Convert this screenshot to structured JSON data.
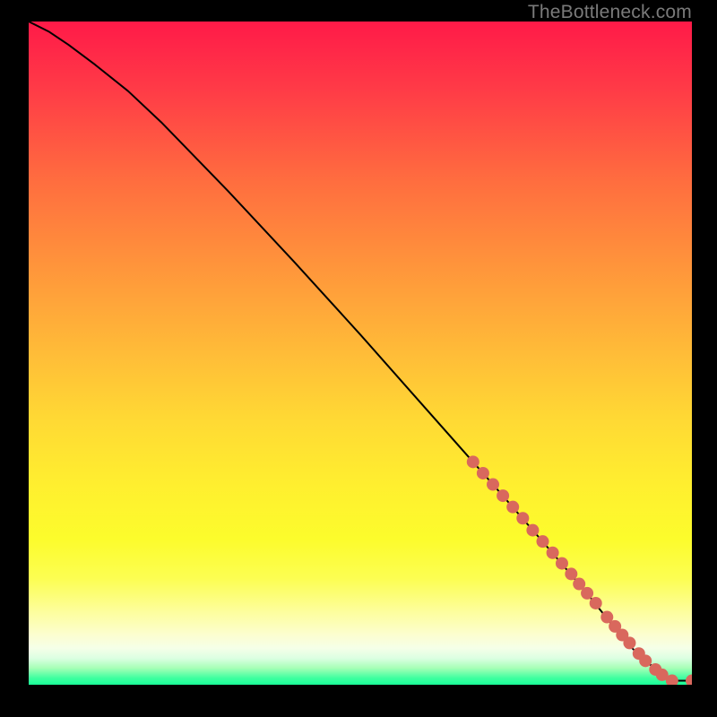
{
  "watermark": "TheBottleneck.com",
  "chart_data": {
    "type": "line",
    "title": "",
    "xlabel": "",
    "ylabel": "",
    "xlim": [
      0,
      100
    ],
    "ylim": [
      0,
      100
    ],
    "grid": false,
    "legend": false,
    "series": [
      {
        "name": "curve",
        "type": "line",
        "color": "#000000",
        "x": [
          0,
          3,
          6,
          10,
          15,
          20,
          30,
          40,
          50,
          60,
          70,
          78,
          84,
          88,
          91,
          93.5,
          95,
          96.5,
          98,
          100
        ],
        "y": [
          100,
          98.5,
          96.5,
          93.5,
          89.5,
          84.8,
          74.5,
          63.8,
          52.8,
          41.5,
          30.2,
          21.0,
          14.0,
          9.0,
          5.5,
          3.2,
          2.0,
          1.0,
          0.6,
          0.6
        ]
      },
      {
        "name": "markers",
        "type": "scatter",
        "color": "#d9685d",
        "radius": 7,
        "x": [
          67.0,
          68.5,
          70.0,
          71.5,
          73.0,
          74.5,
          76.0,
          77.5,
          79.0,
          80.4,
          81.8,
          83.0,
          84.2,
          85.5,
          87.2,
          88.4,
          89.5,
          90.6,
          92.0,
          93.0,
          94.5,
          95.5,
          97.0,
          100.0
        ],
        "y": [
          33.6,
          31.9,
          30.2,
          28.5,
          26.8,
          25.1,
          23.3,
          21.6,
          19.9,
          18.3,
          16.7,
          15.2,
          13.8,
          12.3,
          10.2,
          8.8,
          7.5,
          6.3,
          4.7,
          3.6,
          2.3,
          1.5,
          0.6,
          0.6
        ]
      }
    ]
  }
}
